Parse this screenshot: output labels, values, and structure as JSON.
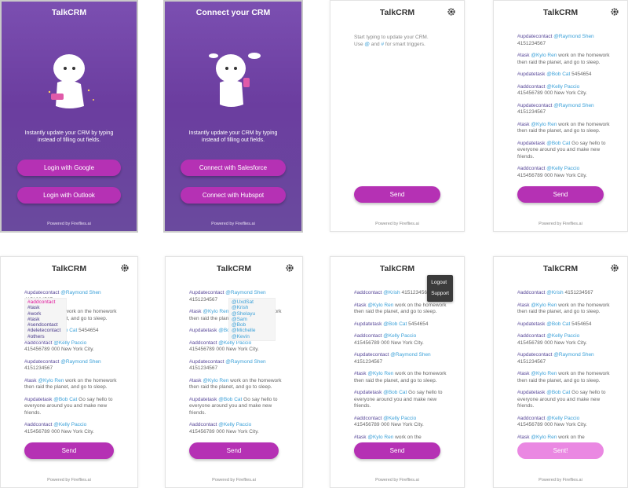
{
  "screens": [
    {
      "title": "TalkCRM",
      "tagline": "Instantly update your CRM by typing instead of filling out fields.",
      "buttons": [
        "Login with Google",
        "Login with Outlook"
      ],
      "powered": "Powered by Fireflies.ai"
    },
    {
      "title": "Connect your CRM",
      "tagline": "Instantly update your CRM by typing instead of filling out fields.",
      "buttons": [
        "Connect with Salesforce",
        "Connect with Hubspot"
      ],
      "powered": "Powered by Fireflies.ai"
    },
    {
      "title": "TalkCRM",
      "hint_line1": "Start typing to update your CRM.",
      "hint_use": "Use",
      "hint_at": "@",
      "hint_and": "and",
      "hint_hash": "#",
      "hint_rest": "for smart triggers.",
      "send": "Send",
      "powered": "Powered by Fireflies.ai"
    },
    {
      "title": "TalkCRM",
      "send": "Send",
      "powered": "Powered by Fireflies.ai"
    },
    {
      "title": "TalkCRM",
      "send": "Send",
      "powered": "Powered by Fireflies.ai"
    },
    {
      "title": "TalkCRM",
      "send": "Send",
      "powered": "Powered by Fireflies.ai"
    },
    {
      "title": "TalkCRM",
      "send": "Send",
      "powered": "Powered by Fireflies.ai"
    },
    {
      "title": "TalkCRM",
      "sent": "Sent!",
      "powered": "Powered by Fireflies.ai"
    }
  ],
  "feed": {
    "e1_tag": "#updatecontact",
    "e1_mention": "@Raymond Shen",
    "e1_text": "4151234567",
    "e2_tag": "#task",
    "e2_mention": "@Kylo Ren",
    "e2_text": "work on the homework then raid the planet, and go to sleep.",
    "e3_tag": "#updatetask",
    "e3_mention": "@Bob Cat",
    "e3_text": "5454654",
    "e4_tag": "#addcontact",
    "e4_mention": "@Kelly Paccio",
    "e4_text": "415456789 000 New York City.",
    "e5_tag": "#updatecontact",
    "e5_mention": "@Raymond Shen",
    "e5_text": "4151234567",
    "e6_tag": "#task",
    "e6_mention": "@Kylo Ren",
    "e6_text": "work on the homework then raid the planet, and go to sleep.",
    "e7_tag": "#updatetask",
    "e7_mention": "@Bob Cat",
    "e7_text": "Go say hello to everyone around you and make new friends.",
    "e8_tag": "#addcontact",
    "e8_mention": "@Kelly Paccio",
    "e8_text": "415456789 000 New York City.",
    "k_tag": "#addcontact",
    "k_mention": "@Krish",
    "k_text": "4151234567",
    "last_tag": "#task",
    "last_mention": "@Kylo Ren",
    "last_text": "work on the"
  },
  "hash_dropdown": [
    "#addcontact",
    "#task",
    "#work",
    "#task",
    "#sendcontact",
    "#deletecontact",
    "#others"
  ],
  "at_dropdown": [
    "@UxdSat",
    "@Krish",
    "@Shelayu",
    "@Sam",
    "@Bob",
    "@Michelle",
    "@Kevin"
  ],
  "menu": {
    "logout": "Logout",
    "support": "Support"
  },
  "colors": {
    "accent": "#b531b4",
    "accent_light": "#ea88e2",
    "mention": "#3aa0d8",
    "purple_bg": "#6b3d9f"
  }
}
